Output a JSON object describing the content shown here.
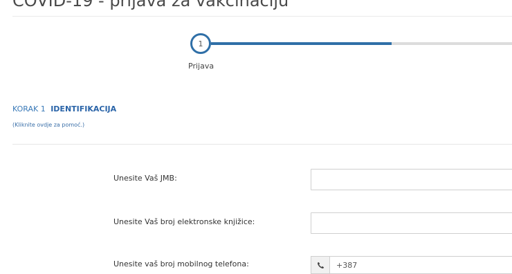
{
  "page": {
    "title": "COVID-19 - prijava za vakcinaciju"
  },
  "stepper": {
    "steps": [
      {
        "number": "1",
        "label": "Prijava",
        "active": true
      }
    ],
    "active_color": "#2f6fa7",
    "inactive_color": "#dcdcdc"
  },
  "section": {
    "step_number": "KORAK 1",
    "step_name": "IDENTIFIKACIJA",
    "help_link": "(Kliknite ovdje za pomoć.)"
  },
  "form": {
    "jmb_label": "Unesite Vaš JMB:",
    "jmb_value": "",
    "card_label": "Unesite Vaš broj elektronske knjižice:",
    "card_value": "",
    "phone_label": "Unesite vaš broj mobilnog telefona:",
    "phone_icon": "phone-icon",
    "phone_value": "+387"
  }
}
